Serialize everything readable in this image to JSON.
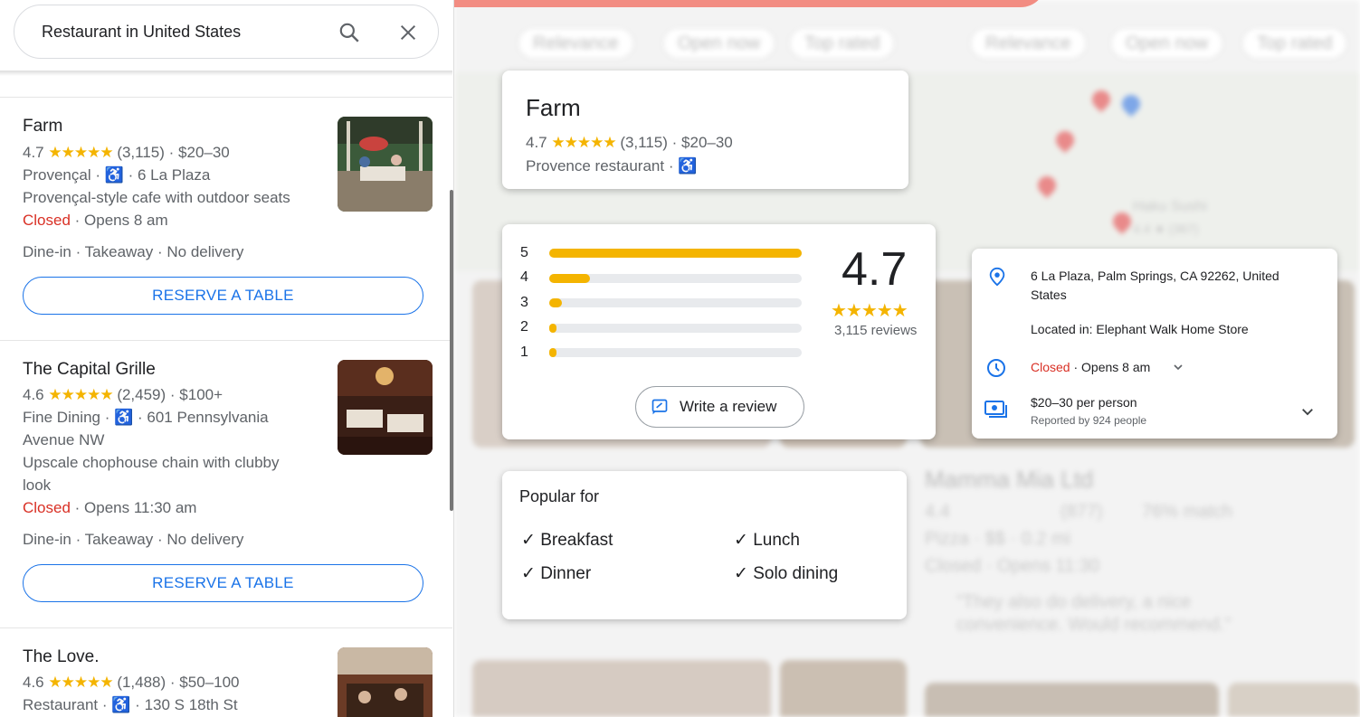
{
  "search": {
    "query": "Restaurant in United States"
  },
  "results": [
    {
      "name": "Farm",
      "rating": "4.7",
      "stars": "★★★★★",
      "reviews": "(3,115)",
      "price": "$20–30",
      "category": "Provençal",
      "address": "6 La Plaza",
      "desc1": "Provençal-style cafe with outdoor seats",
      "desc2": "",
      "status": "Closed",
      "opens": "Opens 8 am",
      "services": "Dine-in · Takeaway · No delivery",
      "reserve": "RESERVE A TABLE"
    },
    {
      "name": "The Capital Grille",
      "rating": "4.6",
      "stars": "★★★★★",
      "reviews": "(2,459)",
      "price": "$100+",
      "category": "Fine Dining",
      "address": "601 Pennsylvania",
      "address2": "Avenue NW",
      "desc1": "Upscale chophouse chain with clubby",
      "desc2": "look",
      "status": "Closed",
      "opens": "Opens 11:30 am",
      "services": "Dine-in · Takeaway · No delivery",
      "reserve": "RESERVE A TABLE"
    },
    {
      "name": "The Love.",
      "rating": "4.6",
      "stars": "★★★★★",
      "reviews": "(1,488)",
      "price": "$50–100",
      "category": "Restaurant",
      "address": "130 S 18th St"
    }
  ],
  "info_card": {
    "name": "Farm",
    "rating": "4.7",
    "stars": "★★★★★",
    "reviews": "(3,115)",
    "price": "$20–30",
    "category": "Provence restaurant"
  },
  "rating_card": {
    "score": "4.7",
    "stars": "★★★★★",
    "count": "3,115 reviews",
    "bars": [
      {
        "label": "5",
        "fraction": 1.0
      },
      {
        "label": "4",
        "fraction": 0.16
      },
      {
        "label": "3",
        "fraction": 0.05
      },
      {
        "label": "2",
        "fraction": 0.03
      },
      {
        "label": "1",
        "fraction": 0.03
      }
    ],
    "write_review": "Write a review"
  },
  "details_card": {
    "address": "6 La Plaza, Palm Springs, CA 92262, United States",
    "located_in": "Located in: Elephant Walk Home Store",
    "status": "Closed",
    "opens": "· Opens 8 am",
    "price": "$20–30 per person",
    "price_note": "Reported by 924 people"
  },
  "popular_card": {
    "title": "Popular for",
    "items": [
      "Breakfast",
      "Lunch",
      "Dinner",
      "Solo dining"
    ]
  },
  "background": {
    "chips": [
      "Relevance",
      "Open now",
      "Top rated",
      "Relevance",
      "Open now",
      "Top rated"
    ],
    "labels": [
      "Haku Sushi",
      "4.4 ★ (367)",
      "Mamma Mia Ltd",
      "4.4",
      "(877)",
      "76% match",
      "Pizza · $$ · 0.2 mi",
      "Closed · Opens 11:30",
      "\"They also do delivery, a nice",
      "convenience. Would recommend.\""
    ]
  },
  "colors": {
    "accent": "#1a73e8",
    "star": "#f4b400",
    "closed": "#d93025",
    "bg_banner": "#f28c82"
  }
}
